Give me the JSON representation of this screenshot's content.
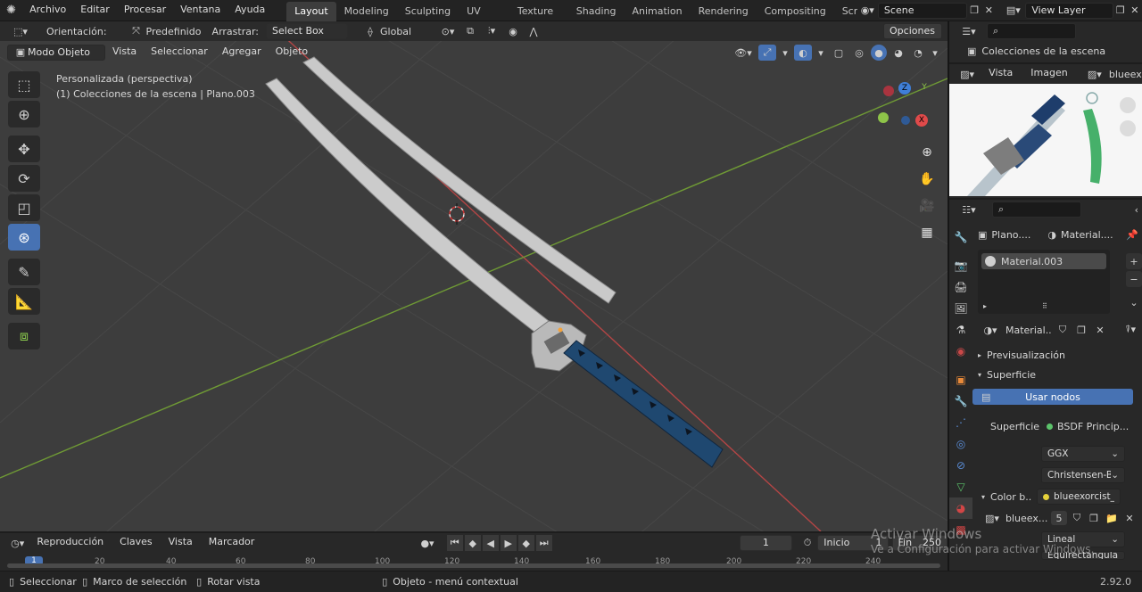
{
  "menubar": {
    "items": [
      "Archivo",
      "Editar",
      "Procesar",
      "Ventana",
      "Ayuda"
    ],
    "workspaces": [
      "Layout",
      "Modeling",
      "Sculpting",
      "UV Editing",
      "Texture Paint",
      "Shading",
      "Animation",
      "Rendering",
      "Compositing",
      "Scripti"
    ],
    "active_workspace": "Layout",
    "scene": "Scene",
    "view_layer": "View Layer"
  },
  "viewport_header": {
    "orientation_label": "Orientación:",
    "orientation_value": "Predefinido",
    "drag_label": "Arrastrar:",
    "drag_value": "Select Box",
    "transform_space": "Global",
    "options": "Opciones",
    "mode": "Modo Objeto",
    "menus": [
      "Vista",
      "Seleccionar",
      "Agregar",
      "Objeto"
    ]
  },
  "viewport_info": {
    "view_name": "Personalizada (perspectiva)",
    "collection_line": "(1) Colecciones de la escena | Plano.003"
  },
  "gizmo": {
    "z": "Z",
    "y": "Y",
    "x": "X"
  },
  "outliner": {
    "root": "Colecciones de la escena"
  },
  "image_editor": {
    "menus": [
      "Vista",
      "Imagen"
    ],
    "image_name": "blueexo"
  },
  "properties": {
    "object_name": "Plano....",
    "material_name": "Material....",
    "slot_name": "Material.003",
    "datablock_name": "Material....",
    "sections": {
      "preview": "Previsualización",
      "surface": "Superficie"
    },
    "use_nodes_button": "Usar nodos",
    "surface_label": "Superficie",
    "surface_value": "BSDF Princip...",
    "distribution": "GGX",
    "subsurface_method": "Christensen-B...",
    "base_color_label": "Color b...",
    "base_color_value": "blueexorcist_...",
    "image_datablock": "blueex...",
    "user_count": "5",
    "interpolation": "Lineal",
    "projection": "Equirectangular"
  },
  "timeline": {
    "menus": [
      "Reproducción",
      "Claves",
      "Vista",
      "Marcador"
    ],
    "current_frame": "1",
    "start_label": "Inicio",
    "start_value": "1",
    "end_label": "Fin",
    "end_value": "250",
    "ruler": [
      "1",
      "20",
      "40",
      "60",
      "80",
      "100",
      "120",
      "140",
      "160",
      "180",
      "200",
      "220",
      "240"
    ]
  },
  "statusbar": {
    "select": "Seleccionar",
    "box_select": "Marco de selección",
    "rotate_view": "Rotar vista",
    "context_menu": "Objeto - menú contextual",
    "version": "2.92.0"
  },
  "watermark": {
    "title": "Activar Windows",
    "subtitle": "Ve a Configuración para activar Windows."
  },
  "colors": {
    "accent": "#4772b3",
    "viewport_bg": "#3d3d3d",
    "x_axis": "#d14646",
    "y_axis": "#7ab03a",
    "z_axis": "#3f7fd8",
    "handle_blue": "#1f4870"
  }
}
